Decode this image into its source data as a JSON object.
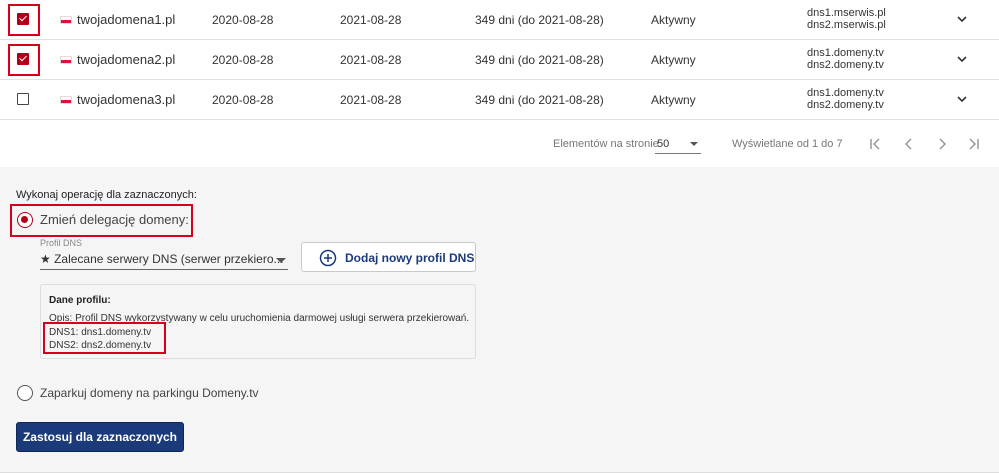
{
  "table": {
    "rows": [
      {
        "checked": true,
        "domain": "twojadomena1.pl",
        "registered": "2020-08-28",
        "expires": "2021-08-28",
        "remaining": "349 dni (do 2021-08-28)",
        "status": "Aktywny",
        "dns1": "dns1.mserwis.pl",
        "dns2": "dns2.mserwis.pl"
      },
      {
        "checked": true,
        "domain": "twojadomena2.pl",
        "registered": "2020-08-28",
        "expires": "2021-08-28",
        "remaining": "349 dni (do 2021-08-28)",
        "status": "Aktywny",
        "dns1": "dns1.domeny.tv",
        "dns2": "dns2.domeny.tv"
      },
      {
        "checked": false,
        "domain": "twojadomena3.pl",
        "registered": "2020-08-28",
        "expires": "2021-08-28",
        "remaining": "349 dni (do 2021-08-28)",
        "status": "Aktywny",
        "dns1": "dns1.domeny.tv",
        "dns2": "dns2.domeny.tv"
      }
    ]
  },
  "pager": {
    "per_page_label": "Elementów na stronie",
    "per_page_value": "50",
    "range": "Wyświetlane od 1 do 7"
  },
  "ops": {
    "title": "Wykonaj operację dla zaznaczonych:",
    "option_delegation": "Zmień delegację domeny:",
    "profile_label": "Profil DNS",
    "profile_value": "★ Zalecane serwery DNS (serwer przekiero...",
    "add_profile": "Dodaj nowy profil DNS",
    "profile_box_title": "Dane profilu:",
    "profile_desc": "Opis: Profil DNS wykorzystywany w celu uruchomienia darmowej usługi serwera przekierowań.",
    "profile_dns1": "DNS1: dns1.domeny.tv",
    "profile_dns2": "DNS2: dns2.domeny.tv",
    "option_parking": "Zaparkuj domeny na parkingu Domeny.tv",
    "apply": "Zastosuj dla zaznaczonych"
  },
  "colors": {
    "accent": "#b3001a",
    "highlight": "#d6001c",
    "primary": "#1a3a7a"
  }
}
